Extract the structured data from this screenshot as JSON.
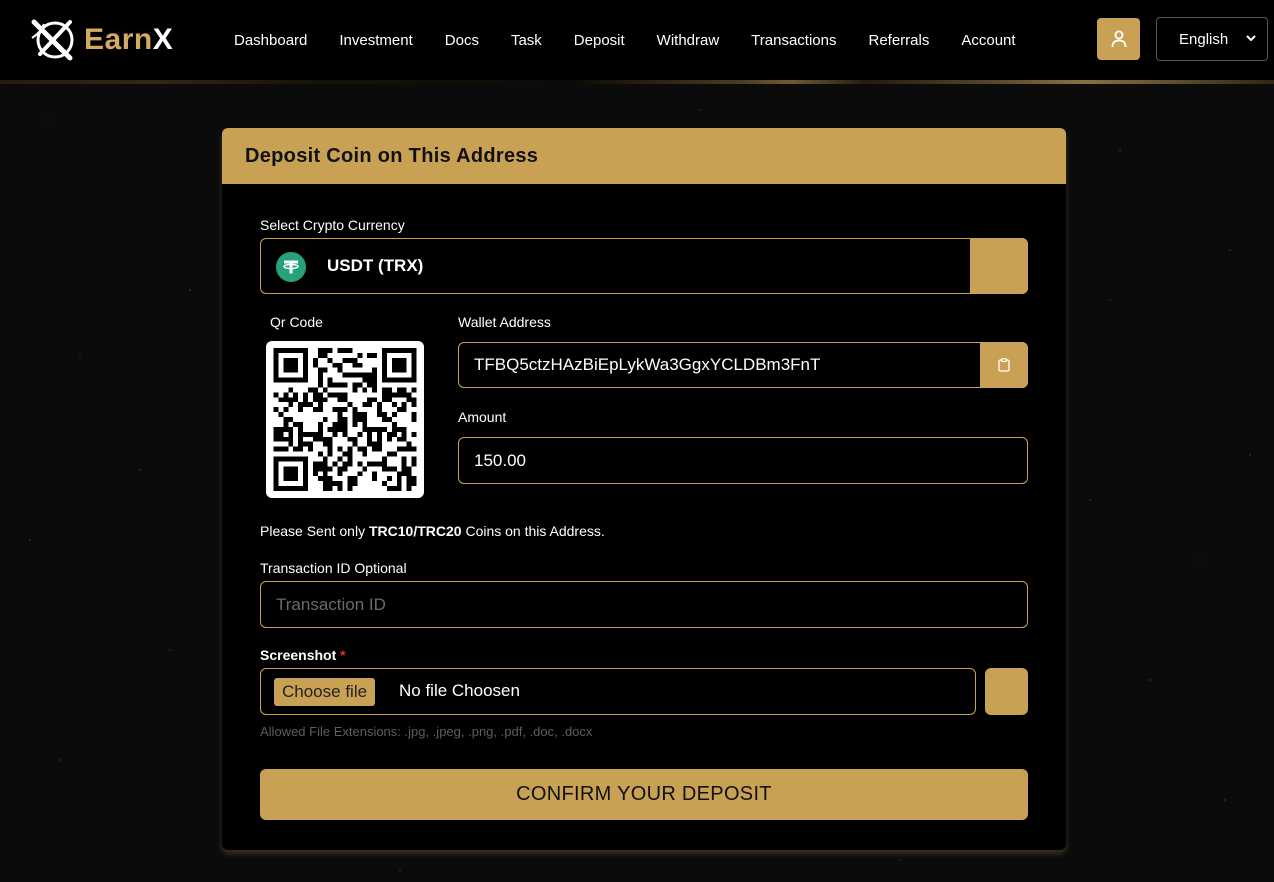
{
  "brand": {
    "name_prefix": "Earn",
    "name_suffix": "X"
  },
  "nav": {
    "items": [
      {
        "label": "Dashboard"
      },
      {
        "label": "Investment"
      },
      {
        "label": "Docs"
      },
      {
        "label": "Task"
      },
      {
        "label": "Deposit"
      },
      {
        "label": "Withdraw"
      },
      {
        "label": "Transactions"
      },
      {
        "label": "Referrals"
      },
      {
        "label": "Account"
      }
    ],
    "user_icon": "user-icon",
    "language": "English"
  },
  "deposit": {
    "title": "Deposit Coin on This Address",
    "currency_label": "Select Crypto Currency",
    "currency_value": "USDT (TRX)",
    "currency_icon": "tether-icon",
    "qr_label": "Qr Code",
    "wallet_label": "Wallet Address",
    "wallet_address": "TFBQ5ctzHAzBiEpLykWa3GgxYCLDBm3FnT",
    "copy_icon": "clipboard-icon",
    "amount_label": "Amount",
    "amount_value": "150.00",
    "notice_prefix": "Please Sent only ",
    "notice_highlight": "TRC10/TRC20",
    "notice_suffix": " Coins on this Address.",
    "txid_label": "Transaction ID Optional",
    "txid_placeholder": "Transaction ID",
    "screenshot_label": "Screenshot",
    "required_mark": "*",
    "choose_file_label": "Choose file",
    "file_name": "No file Choosen",
    "allowed_ext": "Allowed File Extensions: .jpg, .jpeg, .png, .pdf, .doc, .docx",
    "confirm_label": "CONFIRM YOUR DEPOSIT"
  },
  "colors": {
    "accent": "#c9a154",
    "background": "#000000",
    "tether": "#26a17b"
  }
}
